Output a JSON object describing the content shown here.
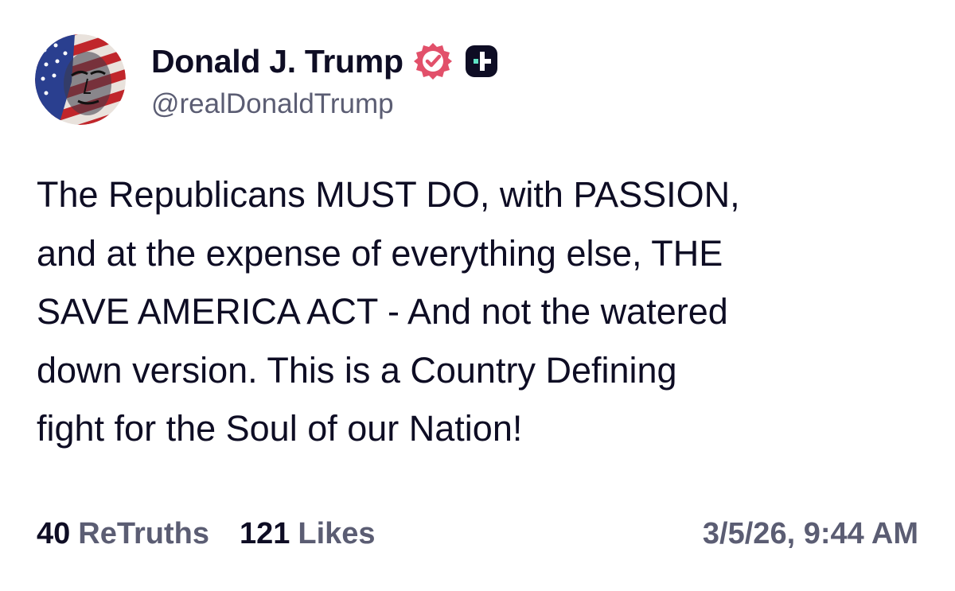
{
  "author": {
    "display_name": "Donald J. Trump",
    "handle": "@realDonaldTrump",
    "avatar_icon": "flag-portrait-avatar",
    "verified_icon": "verified-badge-icon",
    "plus_icon": "truth-plus-badge-icon"
  },
  "post": {
    "text": "The Republicans MUST DO, with PASSION,\nand at the expense of everything else, THE\nSAVE AMERICA ACT - And not the watered\ndown version. This is a Country Defining\nfight for the Soul of our Nation!"
  },
  "stats": {
    "retruths_count": "40",
    "retruths_label": "ReTruths",
    "likes_count": "121",
    "likes_label": "Likes"
  },
  "timestamp": "3/5/26, 9:44 AM",
  "colors": {
    "text_primary": "#0e0d24",
    "text_secondary": "#5b5d73",
    "verified": "#e2506a",
    "plus_badge": "#0e0d24",
    "plus_accent": "#5fe3c4"
  }
}
